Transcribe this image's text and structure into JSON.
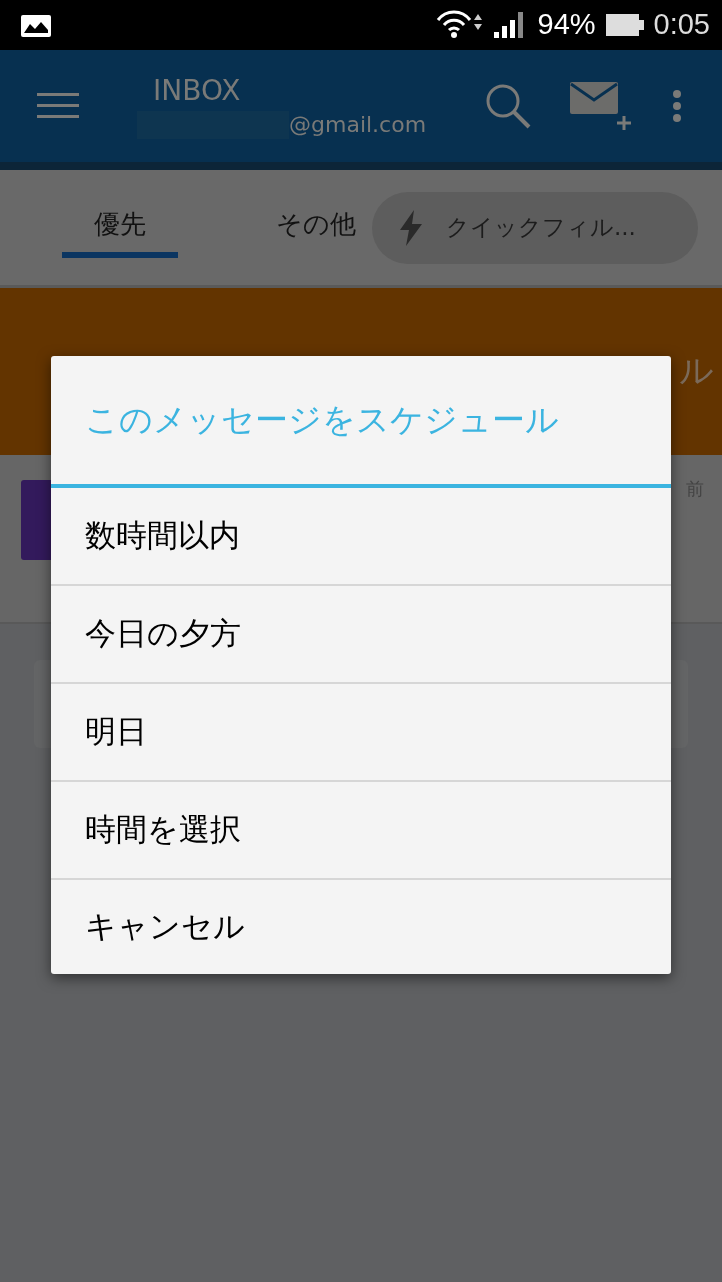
{
  "status_bar": {
    "battery": "94%",
    "time": "0:05"
  },
  "header": {
    "title": "INBOX",
    "account": "@gmail.com"
  },
  "tabs": [
    {
      "label": "優先",
      "selected": true
    },
    {
      "label": "その他",
      "selected": false
    }
  ],
  "quick_filter": {
    "label": "クイックフィル..."
  },
  "background": {
    "banner_fragment": "ル",
    "time_fragment": "前"
  },
  "dialog": {
    "title": "このメッセージをスケジュール",
    "options": [
      "数時間以内",
      "今日の夕方",
      "明日",
      "時間を選択",
      "キャンセル"
    ]
  }
}
